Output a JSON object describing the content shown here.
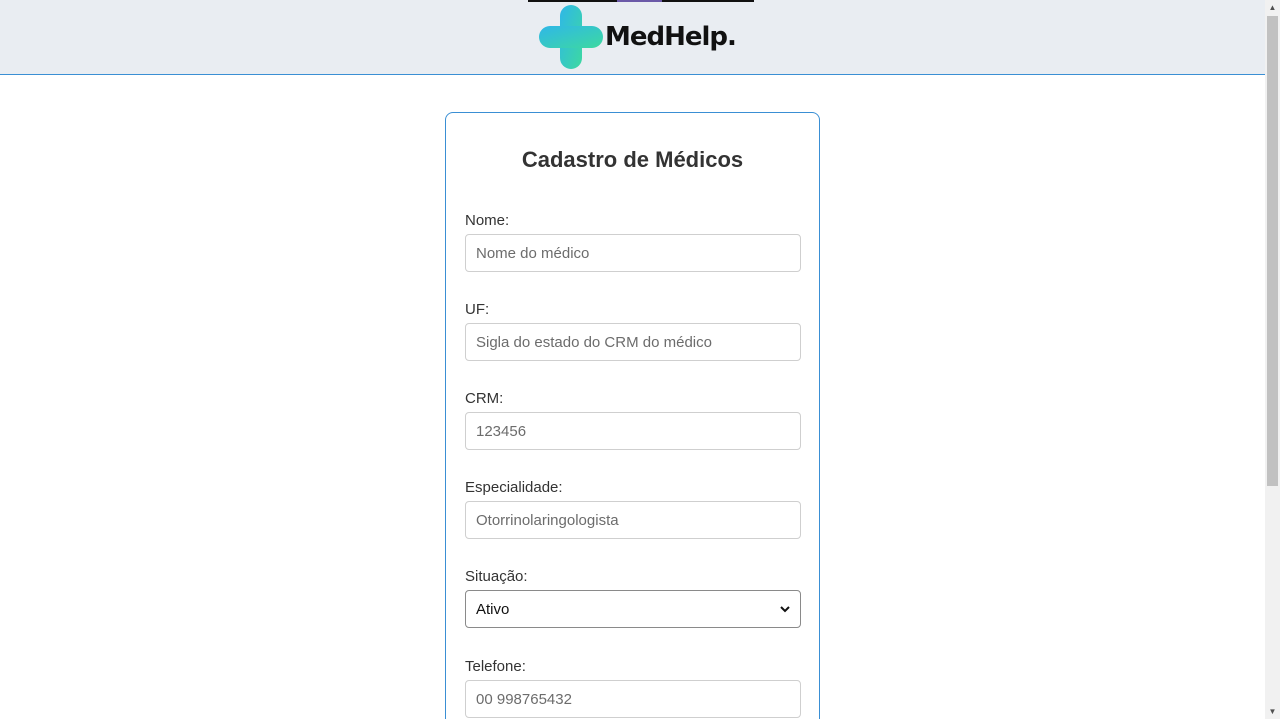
{
  "header": {
    "brand": "MedHelp.",
    "logo_colors": {
      "start": "#2fb7e8",
      "end": "#3dd9a0"
    }
  },
  "form": {
    "title": "Cadastro de Médicos",
    "fields": [
      {
        "label": "Nome:",
        "placeholder": "Nome do médico"
      },
      {
        "label": "UF:",
        "placeholder": "Sigla do estado do CRM do médico"
      },
      {
        "label": "CRM:",
        "placeholder": "123456"
      },
      {
        "label": "Especialidade:",
        "placeholder": "Otorrinolaringologista"
      },
      {
        "label": "Situação:",
        "selected": "Ativo"
      },
      {
        "label": "Telefone:",
        "placeholder": "00 998765432"
      }
    ]
  },
  "colors": {
    "accent": "#3a8fd4",
    "header_bg": "#e9edf2"
  }
}
